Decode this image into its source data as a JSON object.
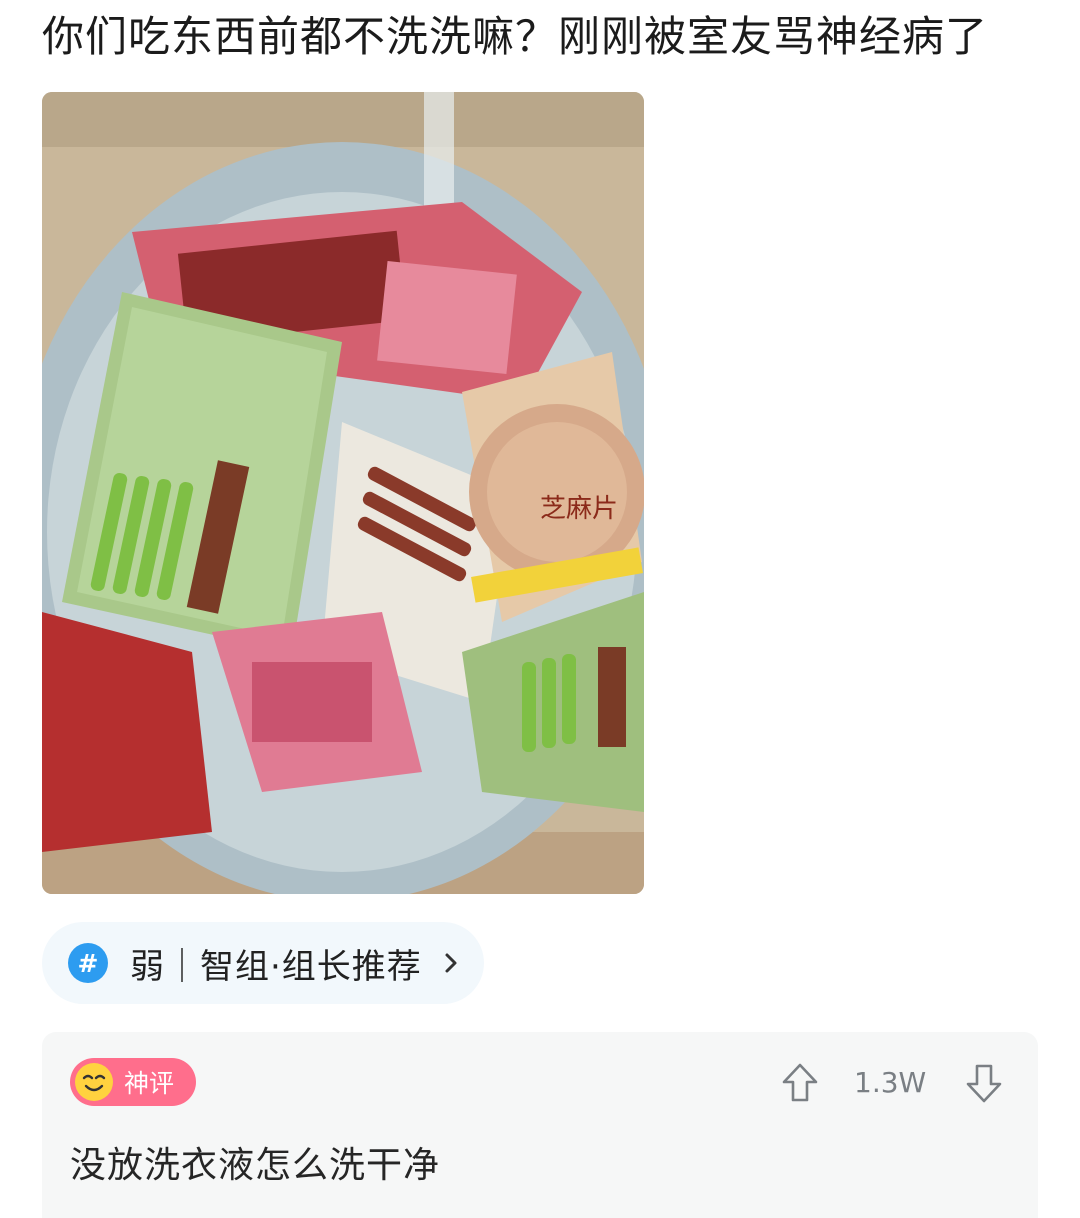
{
  "post": {
    "title": "你们吃东西前都不洗洗嘛？刚刚被室友骂神经病了",
    "photo": {
      "visible_text": [
        "芝麻片"
      ]
    }
  },
  "topic": {
    "icon": "hash-icon",
    "label": "弱｜智组·组长推荐"
  },
  "comment": {
    "badge_label": "神评",
    "upvote_count": "1.3W",
    "text": "没放洗衣液怎么洗干净",
    "icons": [
      "smiley-face-icon",
      "arrow-up-icon",
      "arrow-down-icon"
    ]
  },
  "colors": {
    "badge_pink": "#ff6e8c",
    "hash_blue": "#2d9cf0",
    "chip_bg": "#f2f8fc",
    "card_bg": "#f6f7f7"
  }
}
